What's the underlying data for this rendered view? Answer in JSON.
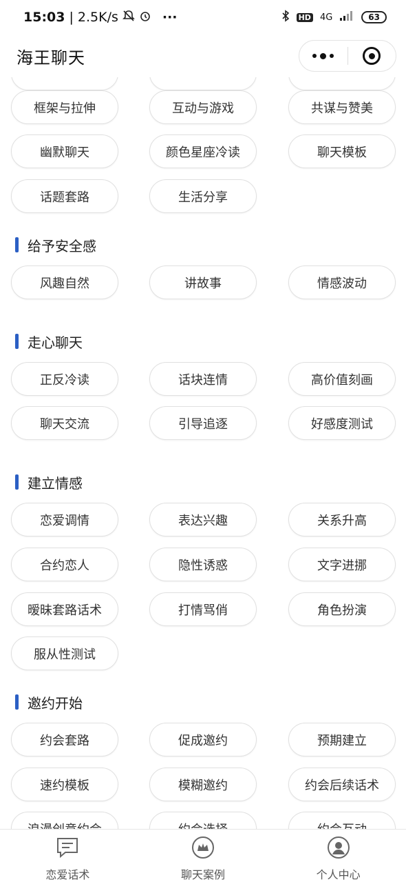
{
  "status": {
    "time": "15:03",
    "speed": "2.5K/s",
    "network": "4G",
    "hd": "HD",
    "battery": "63"
  },
  "header": {
    "title": "海王聊天"
  },
  "sections": {
    "top_partial": {
      "items": [
        "框架与拉伸",
        "互动与游戏",
        "共谋与赞美",
        "幽默聊天",
        "颜色星座冷读",
        "聊天模板",
        "话题套路",
        "生活分享"
      ]
    },
    "security": {
      "title": "给予安全感",
      "items": [
        "风趣自然",
        "讲故事",
        "情感波动"
      ]
    },
    "heart": {
      "title": "走心聊天",
      "items": [
        "正反冷读",
        "话块连情",
        "高价值刻画",
        "聊天交流",
        "引导追逐",
        "好感度测试"
      ]
    },
    "emotion": {
      "title": "建立情感",
      "items": [
        "恋爱调情",
        "表达兴趣",
        "关系升高",
        "合约恋人",
        "隐性诱惑",
        "文字进挪",
        "暧昧套路话术",
        "打情骂俏",
        "角色扮演",
        "服从性测试"
      ]
    },
    "invite": {
      "title": "邀约开始",
      "items": [
        "约会套路",
        "促成邀约",
        "预期建立",
        "速约模板",
        "模糊邀约",
        "约会后续话术",
        "浪漫创意约会",
        "约会选择",
        "约会互动"
      ]
    }
  },
  "tabs": [
    "恋爱话术",
    "聊天案例",
    "个人中心"
  ],
  "colors": {
    "accent": "#2b5fc4",
    "pill_border": "#e0e0e0"
  }
}
